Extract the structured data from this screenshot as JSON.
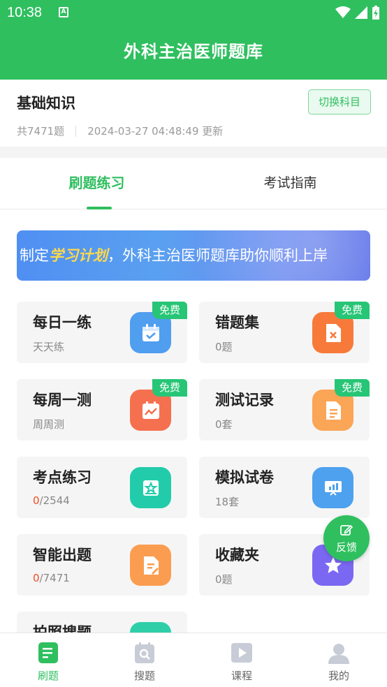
{
  "status_bar": {
    "time": "10:38",
    "sim_badge": "A",
    "icons": [
      "wifi-icon",
      "signal-icon",
      "battery-icon"
    ]
  },
  "app_bar": {
    "title": "外科主治医师题库"
  },
  "subject": {
    "name": "基础知识",
    "count": "共7471题",
    "updated": "2024-03-27 04:48:49 更新",
    "switch_label": "切换科目"
  },
  "tabs": [
    {
      "label": "刷题练习",
      "active": true
    },
    {
      "label": "考试指南",
      "active": false
    }
  ],
  "banner": {
    "prefix": "制定",
    "emphasis": "学习计划",
    "suffix": "，外科主治医师题库助你顺利上岸"
  },
  "cards": [
    {
      "title": "每日一练",
      "sub": "天天练",
      "free": "免费",
      "icon": "calendar-check-icon",
      "color": "#4f9ef0"
    },
    {
      "title": "错题集",
      "sub": "0题",
      "free": "免费",
      "icon": "wrong-doc-icon",
      "color": "#f77a3b"
    },
    {
      "title": "每周一测",
      "sub": "周周测",
      "free": "免费",
      "icon": "chart-calendar-icon",
      "color": "#f5704f"
    },
    {
      "title": "测试记录",
      "sub": "0套",
      "free": "免费",
      "icon": "document-icon",
      "color": "#fba556"
    },
    {
      "title": "考点练习",
      "sub_red": "0",
      "sub_rest": "/2544",
      "icon": "star-badge-icon",
      "color": "#22ccaa"
    },
    {
      "title": "模拟试卷",
      "sub": "18套",
      "icon": "presentation-chart-icon",
      "color": "#4da1ee"
    },
    {
      "title": "智能出题",
      "sub_red": "0",
      "sub_rest": "/7471",
      "icon": "edit-doc-icon",
      "color": "#fb9d50"
    },
    {
      "title": "收藏夹",
      "sub": "0题",
      "icon": "star-icon",
      "color": "#7a68f3"
    },
    {
      "title": "拍照搜题",
      "icon": "camera-icon",
      "color": "#2ecfa8"
    }
  ],
  "feedback": {
    "label": "反馈"
  },
  "bottom_nav": [
    {
      "label": "刷题",
      "icon": "practice-icon",
      "active": true
    },
    {
      "label": "搜题",
      "icon": "search-icon",
      "active": false
    },
    {
      "label": "课程",
      "icon": "video-play-icon",
      "active": false
    },
    {
      "label": "我的",
      "icon": "profile-icon",
      "active": false
    }
  ],
  "colors": {
    "brand_green": "#2fbf5f",
    "free_badge": "#27c576",
    "accent_red": "#f04b23"
  }
}
